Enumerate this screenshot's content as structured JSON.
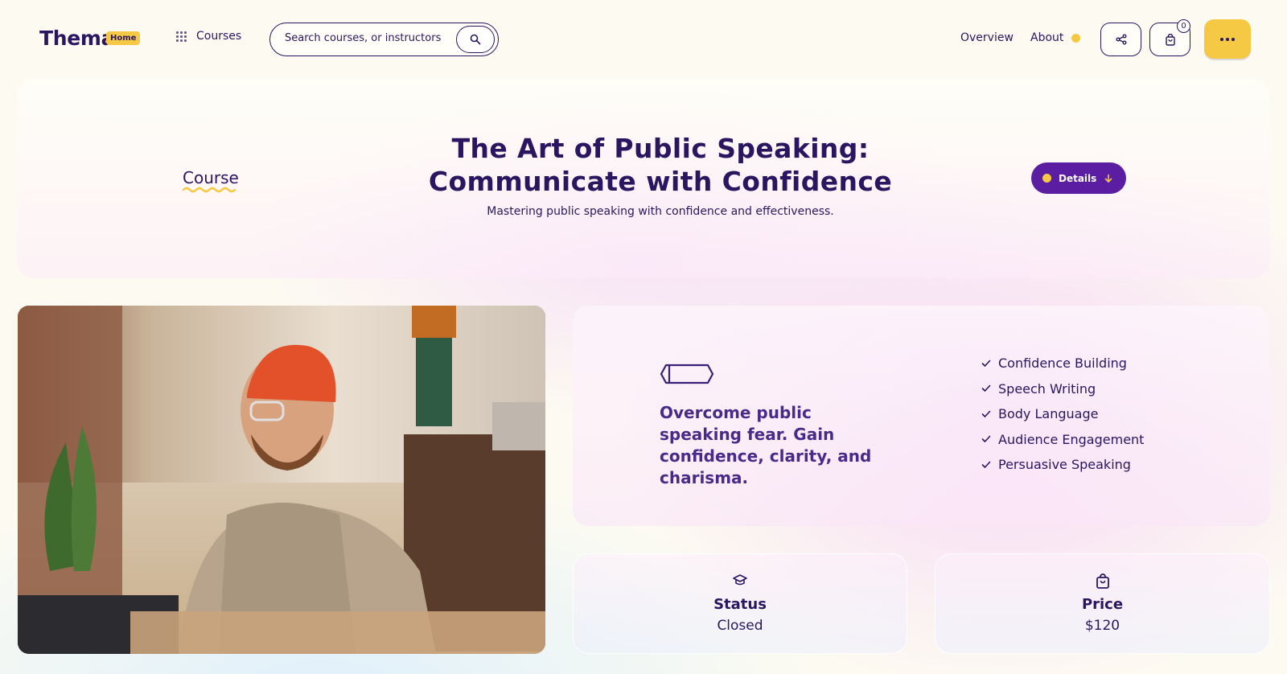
{
  "header": {
    "logo": "Thema",
    "logo_badge": "Home",
    "courses_link": "Courses",
    "search_placeholder": "Search courses, or instructors",
    "nav": {
      "overview": "Overview",
      "about": "About"
    },
    "cart_count": "0"
  },
  "hero": {
    "label": "Course",
    "title_line1": "The Art of Public Speaking:",
    "title_line2": "Communicate with Confidence",
    "subtitle": "Mastering public speaking with confidence and effectiveness.",
    "details_button": "Details"
  },
  "features": {
    "tagline": "Overcome public speaking fear. Gain confidence, clarity, and charisma.",
    "items": [
      "Confidence Building",
      "Speech Writing",
      "Body Language",
      "Audience Engagement",
      "Persuasive Speaking"
    ]
  },
  "stats": {
    "status": {
      "label": "Status",
      "value": "Closed"
    },
    "price": {
      "label": "Price",
      "value": "$120"
    }
  },
  "colors": {
    "primary": "#2a1660",
    "accent": "#f6c945",
    "button_purple": "#5b1ea2"
  }
}
